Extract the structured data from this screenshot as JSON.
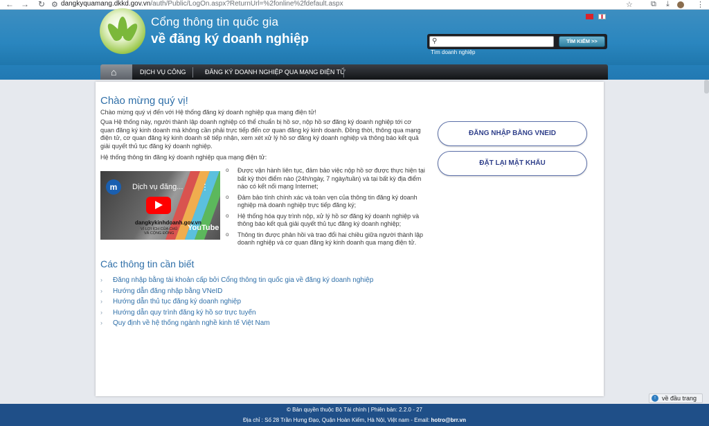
{
  "browser": {
    "url_host": "dangkyquamang.dkkd.gov.vn",
    "url_path": "/auth/Public/LogOn.aspx?ReturnUrl=%2fonline%2fdefault.aspx"
  },
  "header": {
    "title_line1": "Cổng thông tin quốc gia",
    "title_line2": "về đăng ký doanh nghiệp",
    "search_button": "TÌM KIẾM >>",
    "search_hint": "Tìm doanh nghiệp",
    "search_value": ""
  },
  "menu": {
    "items": [
      "DỊCH VỤ CÔNG",
      "ĐĂNG KÝ DOANH NGHIỆP QUA MẠNG ĐIỆN TỬ"
    ]
  },
  "main": {
    "welcome_title": "Chào mừng quý vị!",
    "p1": "Chào mừng quý vị đến với Hệ thống đăng ký doanh nghiệp qua mạng điện tử!",
    "p2": "Qua Hệ thống này, người thành lập doanh nghiệp có thể chuẩn bị hồ sơ, nộp hồ sơ đăng ký doanh nghiệp tới cơ quan đăng ký kinh doanh mà không cần phải trực tiếp đến cơ quan đăng ký kinh doanh. Đồng thời, thông qua mạng điện tử, cơ quan đăng ký kinh doanh sẽ tiếp nhận, xem xét xử lý hồ sơ đăng ký doanh nghiệp và thông báo kết quả giải quyết thủ tục đăng ký doanh nghiệp.",
    "p3": "Hệ thống thông tin đăng ký doanh nghiệp qua mạng điện tử:",
    "video": {
      "avatar_letter": "m",
      "title": "Dịch vụ đăng...",
      "domain": "dangkykinhdoanh.gov.vn",
      "tagline1": "VÌ LỢI ÍCH CỦA CHỦ",
      "tagline2": "VÀ CỘNG ĐỒNG",
      "brand": "YouTube"
    },
    "bullets": [
      "Được vận hành liên tục, đảm bảo việc nộp hồ sơ được thực hiện tại bất kỳ thời điểm nào (24h/ngày, 7 ngày/tuần) và tại bất kỳ địa điểm nào có kết nối mạng Internet;",
      "Đảm bảo tính chính xác và toàn vẹn của thông tin đăng ký doanh nghiệp mà doanh nghiệp trực tiếp đăng ký;",
      "Hệ thống hóa quy trình nộp, xử lý hồ sơ đăng ký doanh nghiệp và thông báo kết quả giải quyết thủ tục đăng ký doanh nghiệp;",
      "Thông tin được phản hồi và trao đổi hai chiều giữa người thành lập doanh nghiệp và cơ quan đăng ký kinh doanh qua mạng điện tử."
    ],
    "info_title": "Các thông tin cần biết",
    "links": [
      "Đăng nhập bằng tài khoản cấp bởi Cổng thông tin quốc gia về đăng ký doanh nghiệp",
      "Hướng dẫn đăng nhập bằng VNeID",
      "Hướng dẫn thủ tục đăng ký doanh nghiệp",
      "Hướng dẫn quy trình đăng ký hồ sơ trực tuyến",
      "Quy định về hệ thống ngành nghề kinh tế Việt Nam"
    ],
    "login_vneid": "ĐĂNG NHẬP BẰNG VNEID",
    "reset_password": "ĐẶT LẠI MẬT KHẨU"
  },
  "footer": {
    "line1": "© Bản quyền thuộc Bộ Tài chính | Phiên bản: 2.2.0 - 27",
    "line2_prefix": "Địa chỉ : Số 28 Trần Hưng Đạo, Quận Hoàn Kiếm, Hà Nội, Việt nam - Email:",
    "email": "hotro@brr.vn"
  },
  "back_to_top": "về đầu trang",
  "colors": {
    "header_blue": "#2a86bf",
    "link_blue": "#2f6fa8",
    "footer_blue": "#1f4f88",
    "button_text": "#2f3f8a"
  }
}
